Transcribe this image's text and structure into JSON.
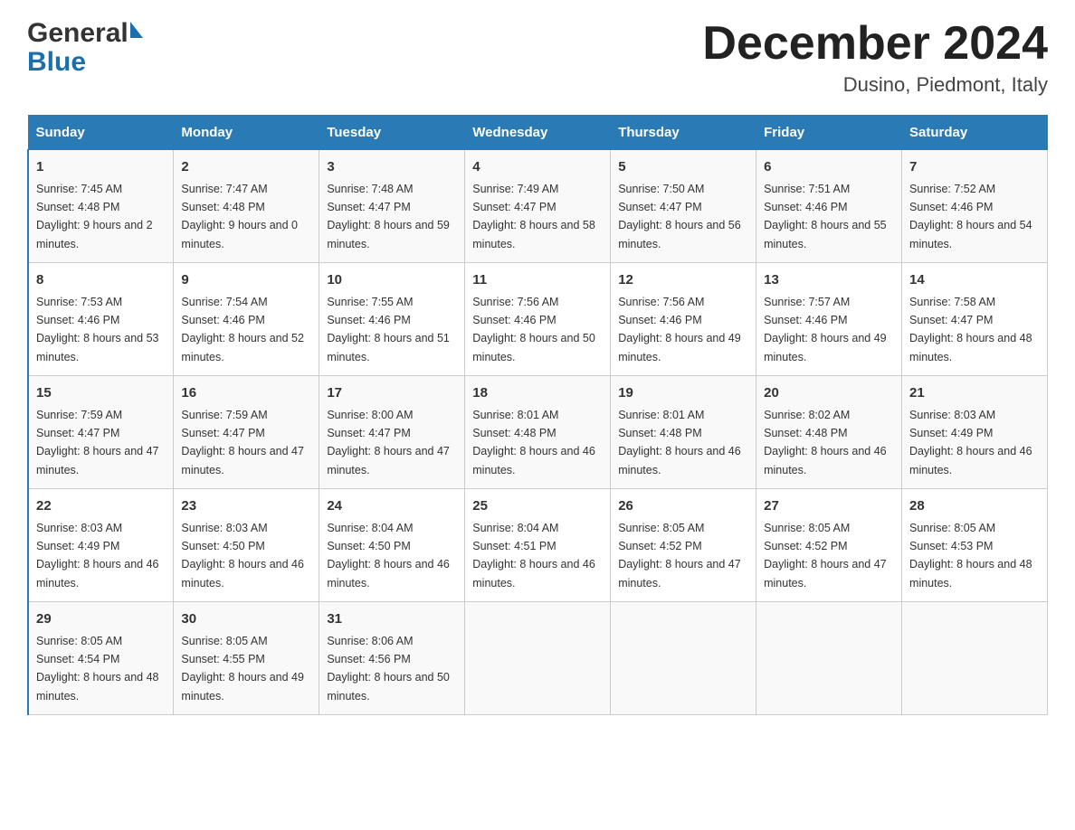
{
  "header": {
    "logo_general": "General",
    "logo_blue": "Blue",
    "month_title": "December 2024",
    "location": "Dusino, Piedmont, Italy"
  },
  "days_of_week": [
    "Sunday",
    "Monday",
    "Tuesday",
    "Wednesday",
    "Thursday",
    "Friday",
    "Saturday"
  ],
  "weeks": [
    [
      {
        "day": "1",
        "sunrise": "7:45 AM",
        "sunset": "4:48 PM",
        "daylight": "9 hours and 2 minutes."
      },
      {
        "day": "2",
        "sunrise": "7:47 AM",
        "sunset": "4:48 PM",
        "daylight": "9 hours and 0 minutes."
      },
      {
        "day": "3",
        "sunrise": "7:48 AM",
        "sunset": "4:47 PM",
        "daylight": "8 hours and 59 minutes."
      },
      {
        "day": "4",
        "sunrise": "7:49 AM",
        "sunset": "4:47 PM",
        "daylight": "8 hours and 58 minutes."
      },
      {
        "day": "5",
        "sunrise": "7:50 AM",
        "sunset": "4:47 PM",
        "daylight": "8 hours and 56 minutes."
      },
      {
        "day": "6",
        "sunrise": "7:51 AM",
        "sunset": "4:46 PM",
        "daylight": "8 hours and 55 minutes."
      },
      {
        "day": "7",
        "sunrise": "7:52 AM",
        "sunset": "4:46 PM",
        "daylight": "8 hours and 54 minutes."
      }
    ],
    [
      {
        "day": "8",
        "sunrise": "7:53 AM",
        "sunset": "4:46 PM",
        "daylight": "8 hours and 53 minutes."
      },
      {
        "day": "9",
        "sunrise": "7:54 AM",
        "sunset": "4:46 PM",
        "daylight": "8 hours and 52 minutes."
      },
      {
        "day": "10",
        "sunrise": "7:55 AM",
        "sunset": "4:46 PM",
        "daylight": "8 hours and 51 minutes."
      },
      {
        "day": "11",
        "sunrise": "7:56 AM",
        "sunset": "4:46 PM",
        "daylight": "8 hours and 50 minutes."
      },
      {
        "day": "12",
        "sunrise": "7:56 AM",
        "sunset": "4:46 PM",
        "daylight": "8 hours and 49 minutes."
      },
      {
        "day": "13",
        "sunrise": "7:57 AM",
        "sunset": "4:46 PM",
        "daylight": "8 hours and 49 minutes."
      },
      {
        "day": "14",
        "sunrise": "7:58 AM",
        "sunset": "4:47 PM",
        "daylight": "8 hours and 48 minutes."
      }
    ],
    [
      {
        "day": "15",
        "sunrise": "7:59 AM",
        "sunset": "4:47 PM",
        "daylight": "8 hours and 47 minutes."
      },
      {
        "day": "16",
        "sunrise": "7:59 AM",
        "sunset": "4:47 PM",
        "daylight": "8 hours and 47 minutes."
      },
      {
        "day": "17",
        "sunrise": "8:00 AM",
        "sunset": "4:47 PM",
        "daylight": "8 hours and 47 minutes."
      },
      {
        "day": "18",
        "sunrise": "8:01 AM",
        "sunset": "4:48 PM",
        "daylight": "8 hours and 46 minutes."
      },
      {
        "day": "19",
        "sunrise": "8:01 AM",
        "sunset": "4:48 PM",
        "daylight": "8 hours and 46 minutes."
      },
      {
        "day": "20",
        "sunrise": "8:02 AM",
        "sunset": "4:48 PM",
        "daylight": "8 hours and 46 minutes."
      },
      {
        "day": "21",
        "sunrise": "8:03 AM",
        "sunset": "4:49 PM",
        "daylight": "8 hours and 46 minutes."
      }
    ],
    [
      {
        "day": "22",
        "sunrise": "8:03 AM",
        "sunset": "4:49 PM",
        "daylight": "8 hours and 46 minutes."
      },
      {
        "day": "23",
        "sunrise": "8:03 AM",
        "sunset": "4:50 PM",
        "daylight": "8 hours and 46 minutes."
      },
      {
        "day": "24",
        "sunrise": "8:04 AM",
        "sunset": "4:50 PM",
        "daylight": "8 hours and 46 minutes."
      },
      {
        "day": "25",
        "sunrise": "8:04 AM",
        "sunset": "4:51 PM",
        "daylight": "8 hours and 46 minutes."
      },
      {
        "day": "26",
        "sunrise": "8:05 AM",
        "sunset": "4:52 PM",
        "daylight": "8 hours and 47 minutes."
      },
      {
        "day": "27",
        "sunrise": "8:05 AM",
        "sunset": "4:52 PM",
        "daylight": "8 hours and 47 minutes."
      },
      {
        "day": "28",
        "sunrise": "8:05 AM",
        "sunset": "4:53 PM",
        "daylight": "8 hours and 48 minutes."
      }
    ],
    [
      {
        "day": "29",
        "sunrise": "8:05 AM",
        "sunset": "4:54 PM",
        "daylight": "8 hours and 48 minutes."
      },
      {
        "day": "30",
        "sunrise": "8:05 AM",
        "sunset": "4:55 PM",
        "daylight": "8 hours and 49 minutes."
      },
      {
        "day": "31",
        "sunrise": "8:06 AM",
        "sunset": "4:56 PM",
        "daylight": "8 hours and 50 minutes."
      },
      null,
      null,
      null,
      null
    ]
  ],
  "labels": {
    "sunrise": "Sunrise:",
    "sunset": "Sunset:",
    "daylight": "Daylight:"
  }
}
